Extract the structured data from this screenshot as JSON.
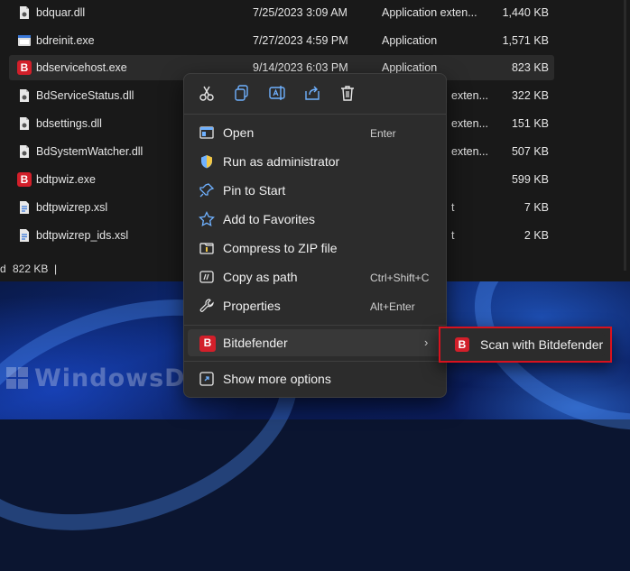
{
  "files": [
    {
      "name": "bdquar.dll",
      "date": "7/25/2023 3:09 AM",
      "type": "Application exten...",
      "size": "1,440 KB",
      "icon": "dll-icon"
    },
    {
      "name": "bdreinit.exe",
      "date": "7/27/2023 4:59 PM",
      "type": "Application",
      "size": "1,571 KB",
      "icon": "exe-icon"
    },
    {
      "name": "bdservicehost.exe",
      "date": "9/14/2023 6:03 PM",
      "type": "Application",
      "size": "823 KB",
      "icon": "bitdefender-icon"
    },
    {
      "name": "BdServiceStatus.dll",
      "date": "",
      "type": "exten...",
      "size": "322 KB",
      "icon": "dll-icon"
    },
    {
      "name": "bdsettings.dll",
      "date": "",
      "type": "exten...",
      "size": "151 KB",
      "icon": "dll-icon"
    },
    {
      "name": "BdSystemWatcher.dll",
      "date": "",
      "type": "exten...",
      "size": "507 KB",
      "icon": "dll-icon"
    },
    {
      "name": "bdtpwiz.exe",
      "date": "",
      "type": "",
      "size": "599 KB",
      "icon": "bitdefender-icon"
    },
    {
      "name": "bdtpwizrep.xsl",
      "date": "",
      "type": "t",
      "size": "7 KB",
      "icon": "xsl-icon"
    },
    {
      "name": "bdtpwizrep_ids.xsl",
      "date": "",
      "type": "t",
      "size": "2 KB",
      "icon": "xsl-icon"
    }
  ],
  "status": {
    "left": "d",
    "selected_size": "822 KB",
    "separator": "|"
  },
  "context_menu": {
    "quick_actions": [
      "cut-icon",
      "copy-icon",
      "rename-icon",
      "share-icon",
      "delete-icon"
    ],
    "items": [
      {
        "label": "Open",
        "shortcut": "Enter",
        "icon": "open-icon"
      },
      {
        "label": "Run as administrator",
        "shortcut": "",
        "icon": "shield-icon"
      },
      {
        "label": "Pin to Start",
        "shortcut": "",
        "icon": "pin-icon"
      },
      {
        "label": "Add to Favorites",
        "shortcut": "",
        "icon": "star-icon"
      },
      {
        "label": "Compress to ZIP file",
        "shortcut": "",
        "icon": "zip-icon"
      },
      {
        "label": "Copy as path",
        "shortcut": "Ctrl+Shift+C",
        "icon": "path-icon"
      },
      {
        "label": "Properties",
        "shortcut": "Alt+Enter",
        "icon": "wrench-icon"
      }
    ],
    "bitdefender": {
      "label": "Bitdefender",
      "badge": "B",
      "chevron": "›"
    },
    "more": {
      "label": "Show more options",
      "icon": "more-options-icon"
    }
  },
  "submenu": {
    "label": "Scan with Bitdefender",
    "badge": "B"
  },
  "watermark": "WindowsDigitals.com",
  "colors": {
    "bitdefender_red": "#d21f2a",
    "highlight_box": "#d8121e",
    "menu_bg": "#2c2c2c"
  }
}
